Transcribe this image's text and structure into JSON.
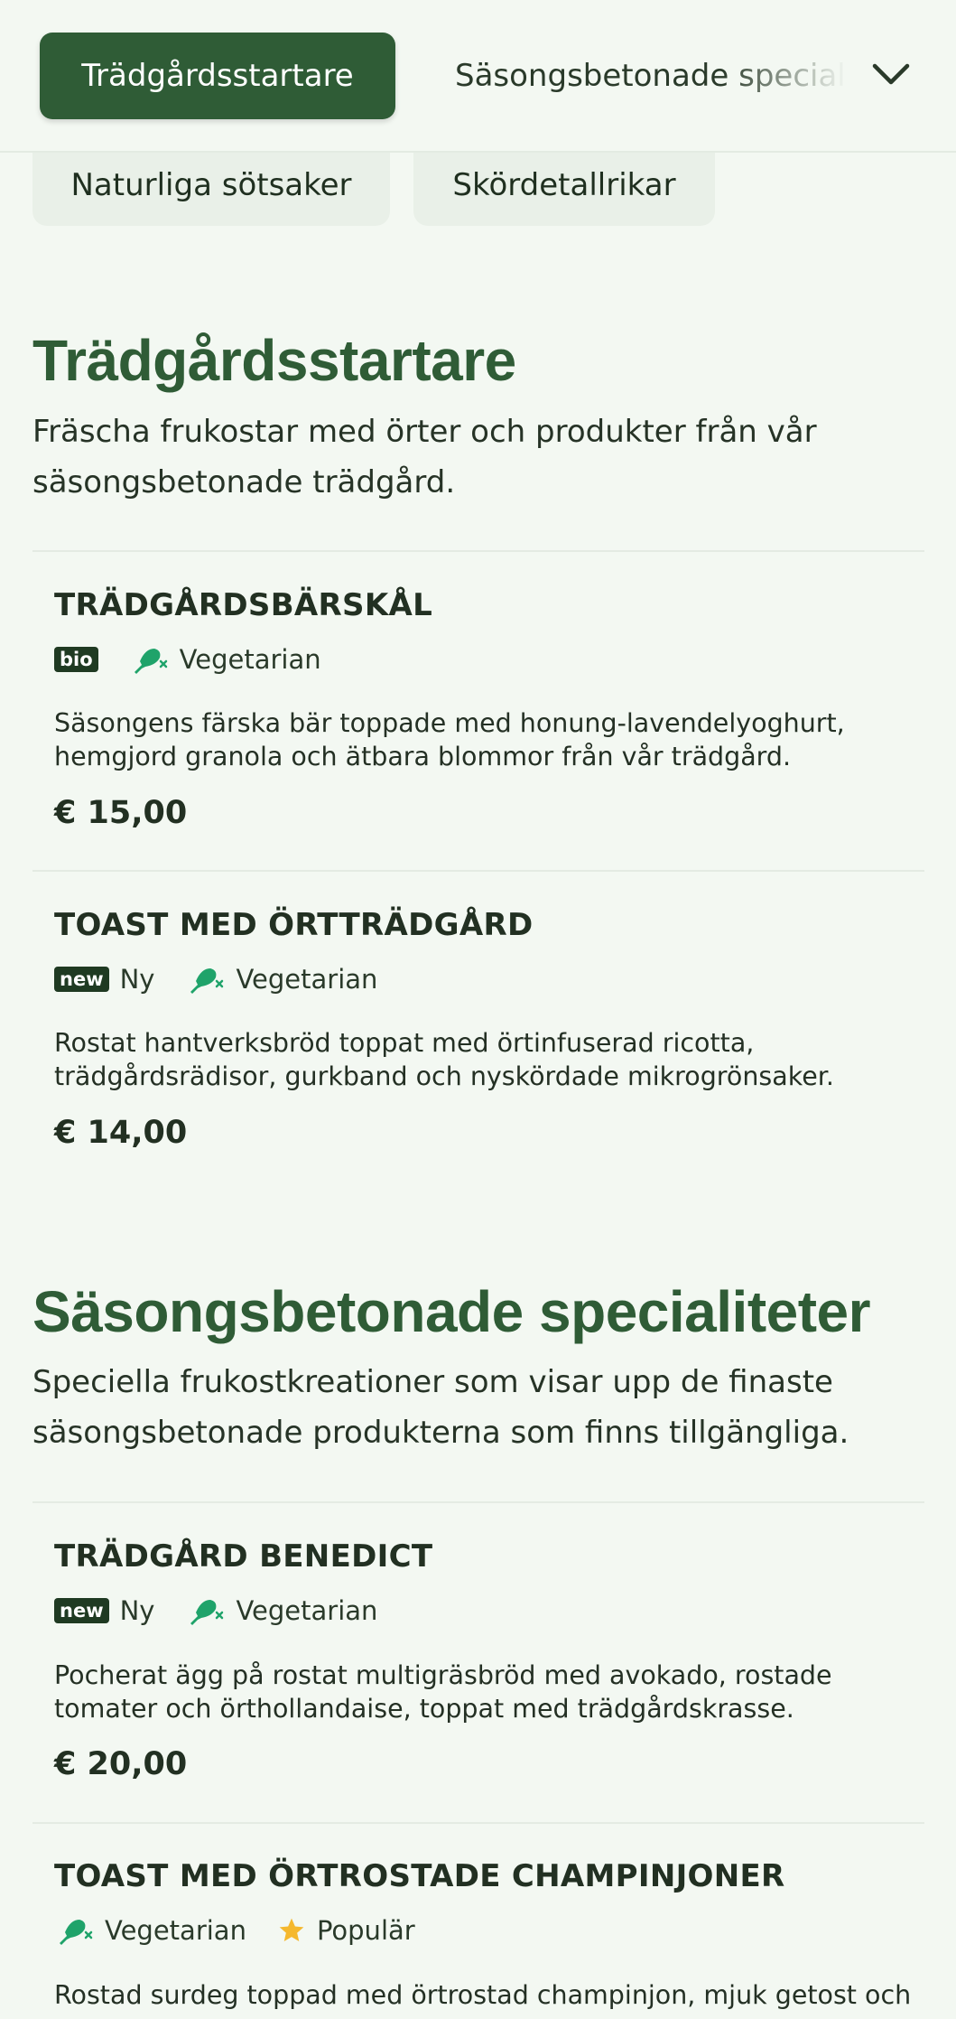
{
  "nav": {
    "active_tab": "Trädgårdsstartare",
    "tabs": [
      "Säsongsbetonade specialiteter"
    ],
    "row2": [
      "Naturliga sötsaker",
      "Skördetallrikar"
    ]
  },
  "sections": [
    {
      "title": "Trädgårdsstartare",
      "description": "Fräscha frukostar med örter och produkter från vår säsongsbetonade trädgård.",
      "items": [
        {
          "name": "TRÄDGÅRDSBÄRSKÅL",
          "badge": "bio",
          "vegetarian": "Vegetarian",
          "description": "Säsongens färska bär toppade med honung-lavendelyoghurt, hemgjord granola och ätbara blommor från vår trädgård.",
          "price": "€ 15,00"
        },
        {
          "name": "TOAST MED ÖRTTRÄDGÅRD",
          "badge": "new",
          "badge_label": "Ny",
          "vegetarian": "Vegetarian",
          "description": "Rostat hantverksbröd toppat med örtinfuserad ricotta, trädgårdsrädisor, gurkband och nyskördade mikrogrönsaker.",
          "price": "€ 14,00"
        }
      ]
    },
    {
      "title": "Säsongsbetonade specialiteter",
      "description": "Speciella frukostkreationer som visar upp de finaste säsongsbetonade produkterna som finns tillgängliga.",
      "items": [
        {
          "name": "TRÄDGÅRD BENEDICT",
          "badge": "new",
          "badge_label": "Ny",
          "vegetarian": "Vegetarian",
          "description": "Pocherat ägg på rostat multigräsbröd med avokado, rostade tomater och örthollandaise, toppat med trädgårdskrasse.",
          "price": "€ 20,00"
        },
        {
          "name": "TOAST MED ÖRTROSTADE CHAMPINJONER",
          "vegetarian": "Vegetarian",
          "popular": "Populär",
          "description": "Rostad surdeg toppad med örtrostad champinjon, mjuk getost och"
        }
      ]
    }
  ],
  "colors": {
    "accent": "#2f5c36",
    "veg_icon": "#1fa36a",
    "star": "#f5b82e",
    "background": "#f3f8f2"
  },
  "icons": {
    "chevron": "chevron-down-icon",
    "vegetarian": "drumstick-crossed-icon",
    "popular": "star-icon"
  }
}
